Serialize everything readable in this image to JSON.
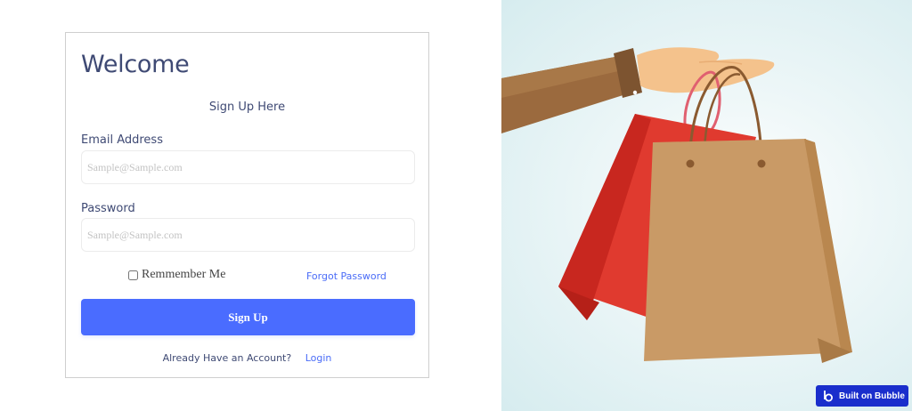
{
  "form": {
    "title": "Welcome",
    "subtitle": "Sign Up Here",
    "email_label": "Email Address",
    "email_placeholder": "Sample@Sample.com",
    "password_label": "Password",
    "password_placeholder": "Sample@Sample.com",
    "remember_label": "Remmember Me",
    "forgot_label": "Forgot Password",
    "submit_label": "Sign Up",
    "already_text": "Already Have an Account?",
    "login_label": "Login"
  },
  "hero": {
    "illustration": "hand-holding-shopping-bags",
    "colors": {
      "sleeve": "#9b6a3e",
      "skin": "#f4c28c",
      "red_bag": "#e03a2f",
      "kraft_bag": "#c99a66"
    }
  },
  "badge": {
    "label": "Built on Bubble",
    "color": "#1a2ecc"
  },
  "colors": {
    "accent": "#4a6cff",
    "text": "#3f4a74"
  }
}
